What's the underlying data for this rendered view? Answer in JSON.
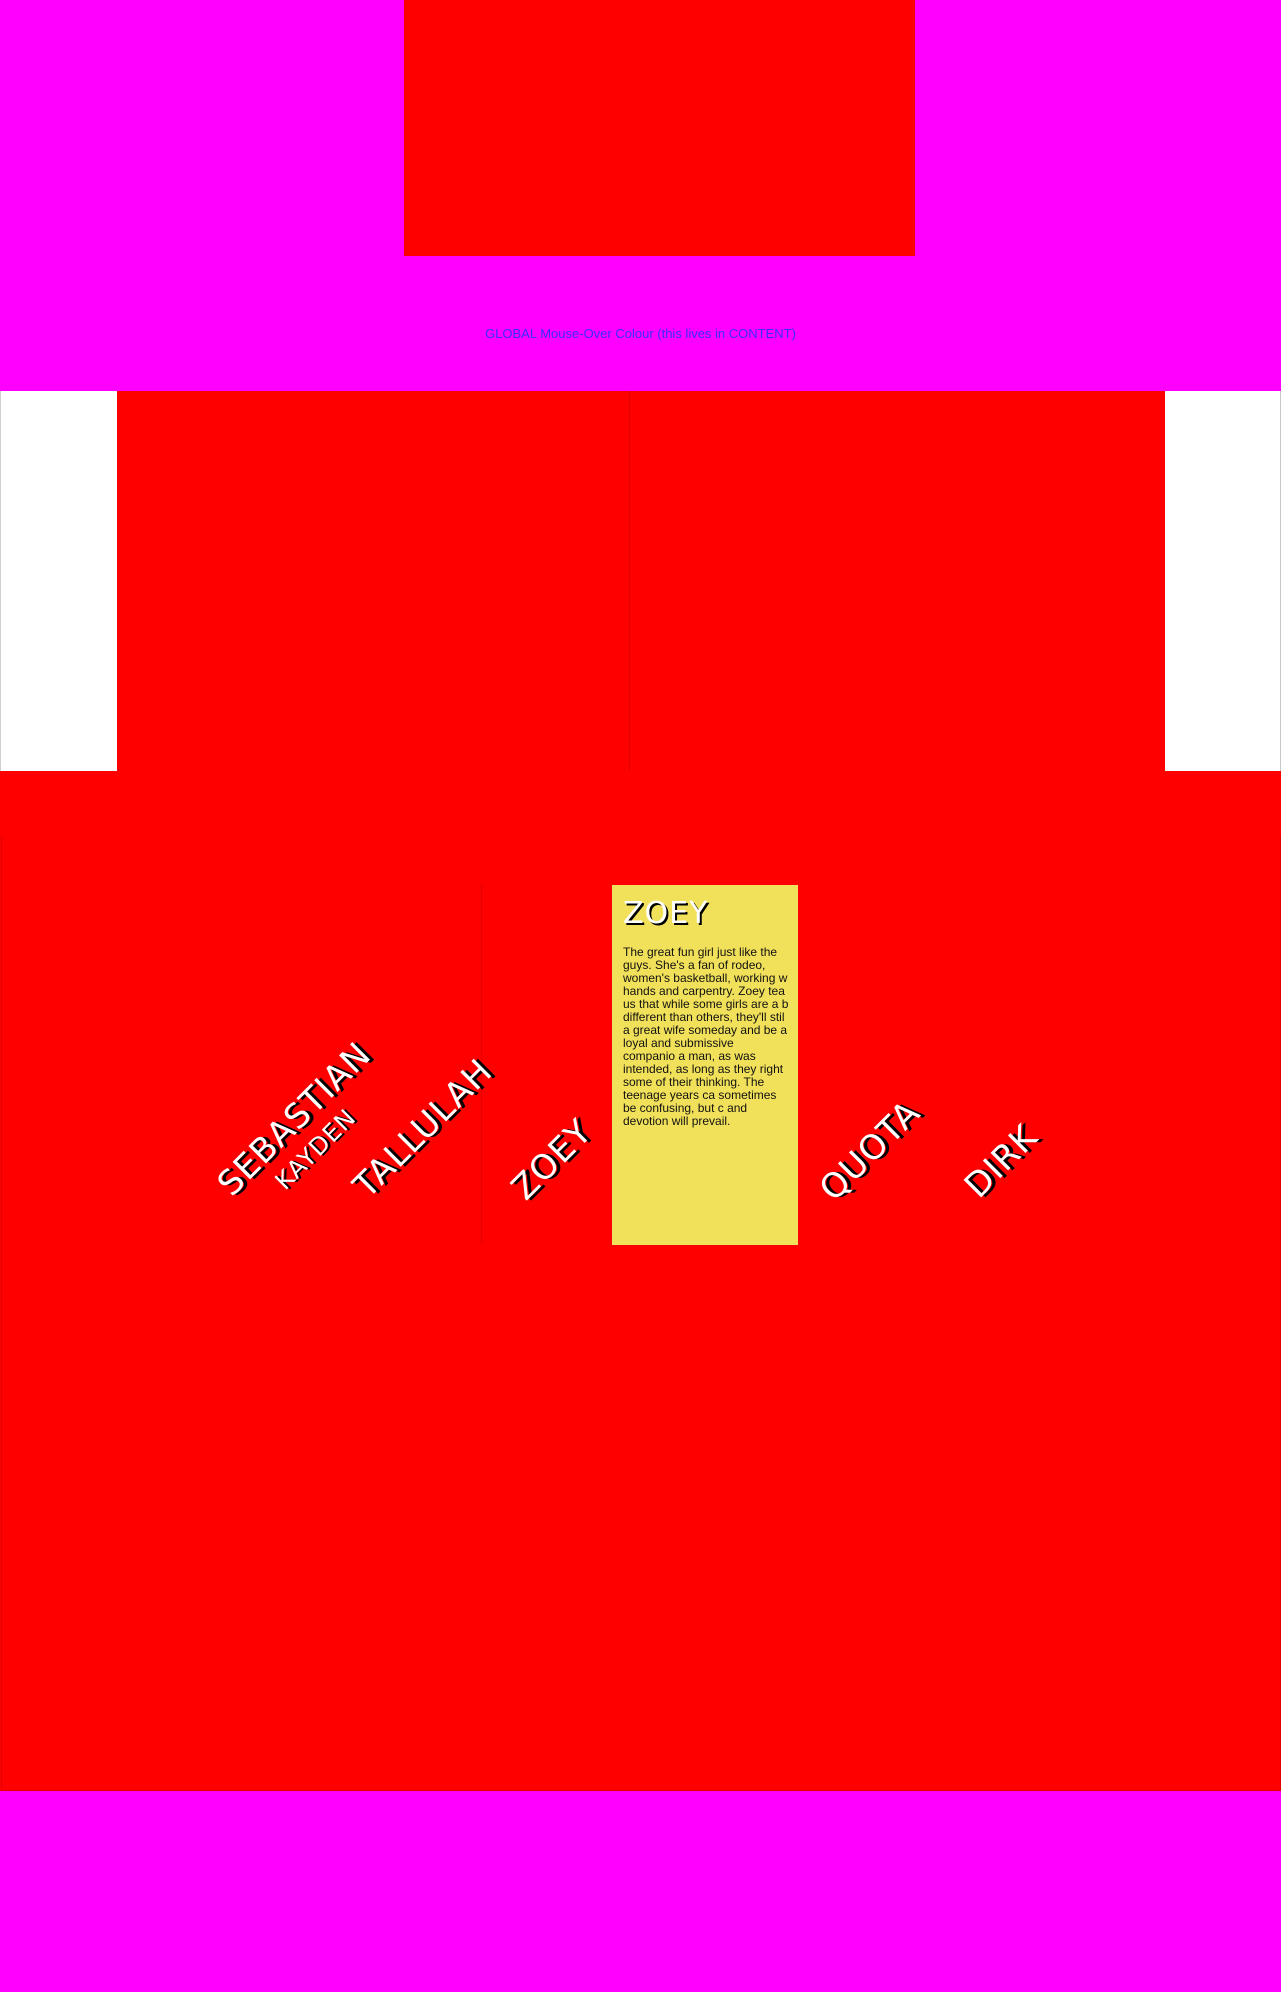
{
  "header": {
    "global_note": "GLOBAL Mouse-Over Colour (this lives in CONTENT)"
  },
  "names": {
    "sebastian": "SEBASTIAN",
    "kayden": "KAYDEN",
    "tallulah": "TALLULAH",
    "zoey": "ZOEY",
    "quota": "QUOTA",
    "dirk": "DIRK"
  },
  "card": {
    "title": "ZOEY",
    "text": "The great fun girl just like the guys. She's a fan of rodeo, women's basketball, working w hands and carpentry. Zoey tea us that while some girls are a b different than others, they'll stil a great wife someday and be a loyal and submissive companio a man, as was intended, as long as they right some of their thinking. The teenage years ca sometimes be confusing, but c and devotion will prevail."
  },
  "colors": {
    "page_background": "#ff00ff",
    "panel_red": "#ff0000",
    "card_yellow": "#f1e05a",
    "note_text": "#3a2cff",
    "name_text": "#ffffff",
    "name_shadow": "#000000"
  }
}
